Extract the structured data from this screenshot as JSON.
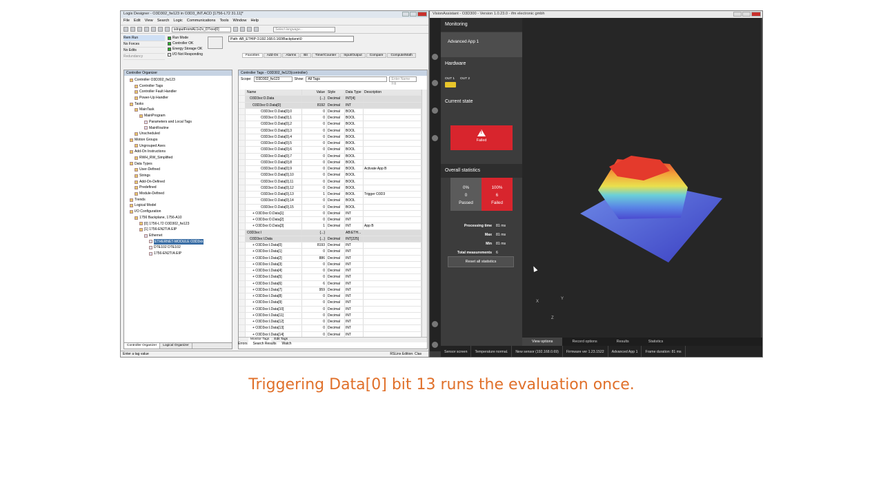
{
  "logix": {
    "title": "Logix Designer - O3D302_fw123 in O3D3_INT.ACD [1756-L72 31.11]*",
    "menu": [
      "File",
      "Edit",
      "View",
      "Search",
      "Logic",
      "Communications",
      "Tools",
      "Window",
      "Help"
    ],
    "routine_dropdown": "isInputFromAL1x2x_DTxxx[0]",
    "language_dropdown": "Select language...",
    "status": {
      "mode": "Rem Run",
      "forces": "No Forces",
      "edits": "No Edits",
      "redundancy": "Redundancy"
    },
    "leds": [
      "Run Mode",
      "Controller OK",
      "Energy Storage OK",
      "I/O Not Responding"
    ],
    "path": "AB_ETHIP-1\\192.168.0.160\\Backplane\\0",
    "instr_tabs": [
      "Favorites",
      "Add-On",
      "Alarms",
      "Bit",
      "Timer/Counter",
      "Input/Output",
      "Compare",
      "Compute/Math"
    ],
    "organizer": {
      "header": "Controller Organizer",
      "tree": [
        {
          "d": 0,
          "t": "Controller O3D302_fw123"
        },
        {
          "d": 1,
          "t": "Controller Tags"
        },
        {
          "d": 1,
          "t": "Controller Fault Handler"
        },
        {
          "d": 1,
          "t": "Power-Up Handler"
        },
        {
          "d": 0,
          "t": "Tasks"
        },
        {
          "d": 1,
          "t": "MainTask"
        },
        {
          "d": 2,
          "t": "MainProgram"
        },
        {
          "d": 3,
          "t": "Parameters and Local Tags"
        },
        {
          "d": 3,
          "t": "MainRoutine"
        },
        {
          "d": 1,
          "t": "Unscheduled"
        },
        {
          "d": 0,
          "t": "Motion Groups"
        },
        {
          "d": 1,
          "t": "Ungrouped Axes"
        },
        {
          "d": 0,
          "t": "Add-On Instructions"
        },
        {
          "d": 1,
          "t": "RWH_RW_Simplified"
        },
        {
          "d": 0,
          "t": "Data Types"
        },
        {
          "d": 1,
          "t": "User-Defined"
        },
        {
          "d": 1,
          "t": "Strings"
        },
        {
          "d": 1,
          "t": "Add-On-Defined"
        },
        {
          "d": 1,
          "t": "Predefined"
        },
        {
          "d": 1,
          "t": "Module-Defined"
        },
        {
          "d": 0,
          "t": "Trends"
        },
        {
          "d": 0,
          "t": "Logical Model"
        },
        {
          "d": 0,
          "t": "I/O Configuration"
        },
        {
          "d": 1,
          "t": "1756 Backplane, 1756-A10"
        },
        {
          "d": 2,
          "t": "[0] 1756-L72 O3D302_fw123"
        },
        {
          "d": 2,
          "t": "[1] 1756-EN2T/A EIP"
        },
        {
          "d": 3,
          "t": "Ethernet"
        },
        {
          "d": 4,
          "t": "ETHERNET-MODULE O3D3xx",
          "sel": true
        },
        {
          "d": 4,
          "t": "DTE102 DTE102"
        },
        {
          "d": 4,
          "t": "1756-EN2T/A EIP"
        }
      ],
      "tabs": [
        "Controller Organizer",
        "Logical Organizer"
      ]
    },
    "tags": {
      "header": "Controller Tags - O3D302_fw123(controller)",
      "scope_label": "Scope:",
      "scope_value": "O3D302_fw123",
      "show_label": "Show:",
      "show_value": "All Tags",
      "filter": "Enter Name Filt",
      "columns": [
        "Name",
        "Value",
        "Style",
        "Data Type",
        "Description"
      ],
      "rows": [
        [
          "O3D3xx:O.Data",
          "{...}",
          "Decimal",
          "INT[4]",
          "",
          1
        ],
        [
          "O3D3xx:O.Data[0]",
          "8192",
          "Decimal",
          "INT",
          "",
          1
        ],
        [
          "O3D3xx:O.Data[0].0",
          "0",
          "Decimal",
          "BOOL",
          "",
          0
        ],
        [
          "O3D3xx:O.Data[0].1",
          "0",
          "Decimal",
          "BOOL",
          "",
          0
        ],
        [
          "O3D3xx:O.Data[0].2",
          "0",
          "Decimal",
          "BOOL",
          "",
          0
        ],
        [
          "O3D3xx:O.Data[0].3",
          "0",
          "Decimal",
          "BOOL",
          "",
          0
        ],
        [
          "O3D3xx:O.Data[0].4",
          "0",
          "Decimal",
          "BOOL",
          "",
          0
        ],
        [
          "O3D3xx:O.Data[0].5",
          "0",
          "Decimal",
          "BOOL",
          "",
          0
        ],
        [
          "O3D3xx:O.Data[0].6",
          "0",
          "Decimal",
          "BOOL",
          "",
          0
        ],
        [
          "O3D3xx:O.Data[0].7",
          "0",
          "Decimal",
          "BOOL",
          "",
          0
        ],
        [
          "O3D3xx:O.Data[0].8",
          "0",
          "Decimal",
          "BOOL",
          "",
          0
        ],
        [
          "O3D3xx:O.Data[0].9",
          "0",
          "Decimal",
          "BOOL",
          "Activate App B",
          0
        ],
        [
          "O3D3xx:O.Data[0].10",
          "0",
          "Decimal",
          "BOOL",
          "",
          0
        ],
        [
          "O3D3xx:O.Data[0].11",
          "0",
          "Decimal",
          "BOOL",
          "",
          0
        ],
        [
          "O3D3xx:O.Data[0].12",
          "0",
          "Decimal",
          "BOOL",
          "",
          0
        ],
        [
          "O3D3xx:O.Data[0].13",
          "1",
          "Decimal",
          "BOOL",
          "Trigger O3D3",
          0
        ],
        [
          "O3D3xx:O.Data[0].14",
          "0",
          "Decimal",
          "BOOL",
          "",
          0
        ],
        [
          "O3D3xx:O.Data[0].15",
          "0",
          "Decimal",
          "BOOL",
          "",
          0
        ],
        [
          "+ O3D3xx:O.Data[1]",
          "0",
          "Decimal",
          "INT",
          "",
          0
        ],
        [
          "+ O3D3xx:O.Data[2]",
          "0",
          "Decimal",
          "INT",
          "",
          0
        ],
        [
          "+ O3D3xx:O.Data[3]",
          "1",
          "Decimal",
          "INT",
          "App B",
          0
        ],
        [
          "O3D3xx:I",
          "{...}",
          "",
          "AB:ETH...",
          "",
          1
        ],
        [
          "O3D3xx:I.Data",
          "{...}",
          "Decimal",
          "INT[225]",
          "",
          1
        ],
        [
          "+ O3D3xx:I.Data[0]",
          "8193",
          "Decimal",
          "INT",
          "",
          0
        ],
        [
          "+ O3D3xx:I.Data[1]",
          "0",
          "Decimal",
          "INT",
          "",
          0
        ],
        [
          "+ O3D3xx:I.Data[2]",
          "886",
          "Decimal",
          "INT",
          "",
          0
        ],
        [
          "+ O3D3xx:I.Data[3]",
          "0",
          "Decimal",
          "INT",
          "",
          0
        ],
        [
          "+ O3D3xx:I.Data[4]",
          "0",
          "Decimal",
          "INT",
          "",
          0
        ],
        [
          "+ O3D3xx:I.Data[5]",
          "0",
          "Decimal",
          "INT",
          "",
          0
        ],
        [
          "+ O3D3xx:I.Data[6]",
          "6",
          "Decimal",
          "INT",
          "",
          0
        ],
        [
          "+ O3D3xx:I.Data[7]",
          "959",
          "Decimal",
          "INT",
          "",
          0
        ],
        [
          "+ O3D3xx:I.Data[8]",
          "0",
          "Decimal",
          "INT",
          "",
          0
        ],
        [
          "+ O3D3xx:I.Data[9]",
          "0",
          "Decimal",
          "INT",
          "",
          0
        ],
        [
          "+ O3D3xx:I.Data[10]",
          "0",
          "Decimal",
          "INT",
          "",
          0
        ],
        [
          "+ O3D3xx:I.Data[11]",
          "0",
          "Decimal",
          "INT",
          "",
          0
        ],
        [
          "+ O3D3xx:I.Data[12]",
          "0",
          "Decimal",
          "INT",
          "",
          0
        ],
        [
          "+ O3D3xx:I.Data[13]",
          "0",
          "Decimal",
          "INT",
          "",
          0
        ],
        [
          "+ O3D3xx:I.Data[14]",
          "0",
          "Decimal",
          "INT",
          "",
          0
        ]
      ],
      "bottom_tabs": [
        "Monitor Tags",
        "Edit Tags"
      ]
    },
    "bottom_panel": [
      "Errors",
      "Search Results",
      "Watch"
    ],
    "statusbar_left": "Enter a tag value",
    "statusbar_right": "RSLinx Edition: Clas"
  },
  "vision": {
    "title": "VisionAssistant - O3D300 - Version 1.0.23.0 - ifm electronic gmbh",
    "monitoring": "Monitoring",
    "app": "Advanced App 1",
    "hardware": "Hardware",
    "out1": "OUT 1",
    "out2": "OUT 2",
    "current_state": "Current state",
    "state_text": "Failed",
    "overall": "Overall statistics",
    "passed_pct": "0%",
    "passed_n": "0",
    "passed_label": "Passed",
    "failed_pct": "100%",
    "failed_n": "6",
    "failed_label": "Failed",
    "processing_label": "Processing time",
    "processing_val": "81 ms",
    "max_label": "Max",
    "max_val": "81 ms",
    "min_label": "Min",
    "min_val": "81 ms",
    "total_label": "Total measurements",
    "total_val": "6",
    "reset_label": "Reset all statistics",
    "axes": {
      "x": "X",
      "y": "Y",
      "z": "Z"
    },
    "view_tabs": [
      "View options",
      "Record options",
      "Results",
      "Statistics"
    ],
    "statusbar": [
      "Sensor screen",
      "Temperature normal.",
      "New sensor (192.168.0.69)",
      "Firmware ver 1.23.1522",
      "Advanced App 1",
      "Frame duration: 81 ms"
    ],
    "colors": {
      "fail": "#d8252d",
      "led_on": "#e9c62b"
    }
  },
  "caption": "Triggering Data[0] bit 13 runs the evaluation once."
}
